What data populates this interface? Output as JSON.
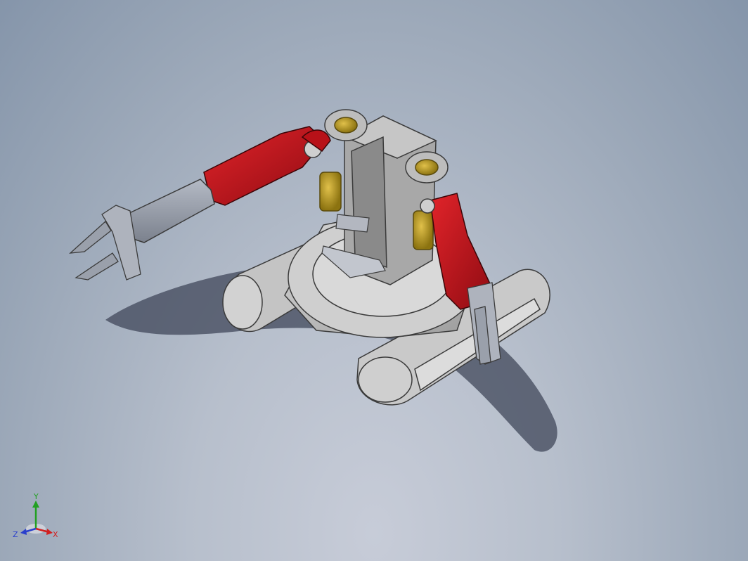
{
  "colors": {
    "background_top": "#8595aa",
    "background_bottom": "#c7ccd8",
    "shadow": "#4a5260",
    "base_gray": "#c9c9c9",
    "edge_dark": "#3b3b3b",
    "arm_red": "#c8141c",
    "arm_red_dark": "#8a0b10",
    "gripper_gray": "#9aa0ab",
    "bushing_gold": "#b99a1e",
    "axis_x": "#d22020",
    "axis_y": "#22a022",
    "axis_z": "#2a3fcc"
  },
  "triad": {
    "x_label": "X",
    "y_label": "Y",
    "z_label": "Z",
    "icon": "axis-triad-icon"
  }
}
